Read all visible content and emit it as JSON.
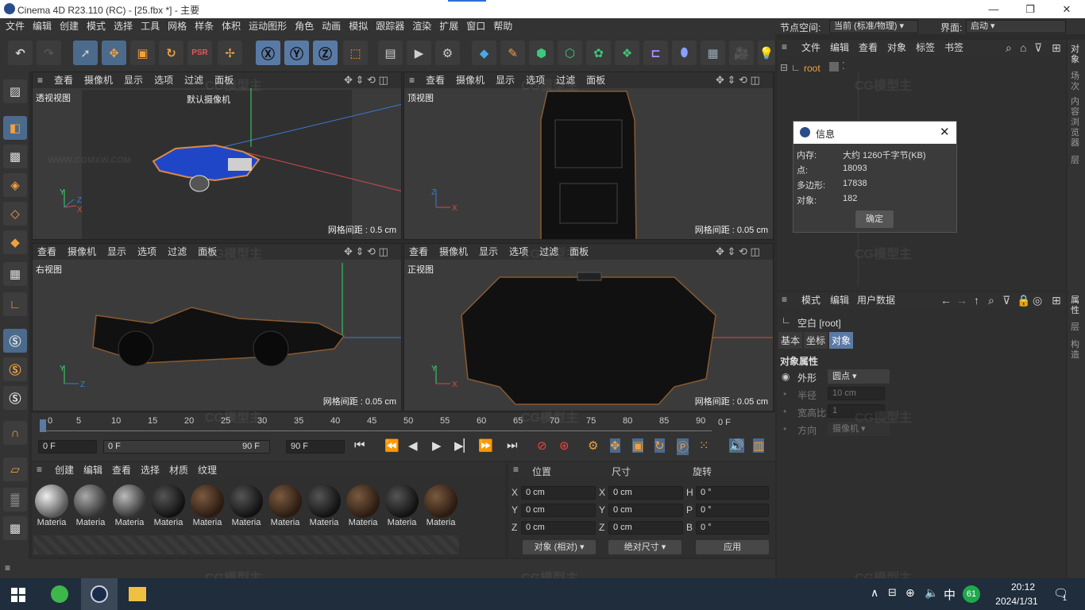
{
  "window": {
    "title": "Cinema 4D R23.110 (RC) - [25.fbx *] - 主要",
    "min": "—",
    "max": "❐",
    "close": "✕"
  },
  "menu": [
    "文件",
    "编辑",
    "创建",
    "模式",
    "选择",
    "工具",
    "网格",
    "样条",
    "体积",
    "运动图形",
    "角色",
    "动画",
    "模拟",
    "跟踪器",
    "渲染",
    "扩展",
    "窗口",
    "帮助"
  ],
  "node_space": {
    "label": "节点空间:",
    "value": "当前 (标准/物理)"
  },
  "interface": {
    "label": "界面:",
    "value": "启动"
  },
  "viewport_menu": [
    "查看",
    "摄像机",
    "显示",
    "选项",
    "过滤",
    "面板"
  ],
  "viewport_menu_short": [
    "查看",
    "摄像机",
    "显示",
    "选项",
    "过滤",
    "面板"
  ],
  "viewports": {
    "persp": {
      "name": "透视视图",
      "camera": "默认摄像机",
      "grid": "网格间距 : 0.5 cm"
    },
    "top": {
      "name": "顶视图",
      "grid": "网格间距 : 0.05 cm"
    },
    "right": {
      "name": "右视图",
      "grid": "网格间距 : 0.05 cm"
    },
    "front": {
      "name": "正视图",
      "grid": "网格间距 : 0.05 cm"
    }
  },
  "timeline": {
    "ticks": [
      "0",
      "5",
      "10",
      "15",
      "20",
      "25",
      "30",
      "35",
      "40",
      "45",
      "50",
      "55",
      "60",
      "65",
      "70",
      "75",
      "80",
      "85",
      "90"
    ],
    "end_frame": "0 F",
    "current": "0 F",
    "start": "0 F",
    "max_a": "90 F",
    "max_b": "90 F"
  },
  "materials": {
    "menu": [
      "创建",
      "编辑",
      "查看",
      "选择",
      "材质",
      "纹理"
    ],
    "label": "Materia",
    "count": 11
  },
  "coords": {
    "headers": {
      "pos": "位置",
      "size": "尺寸",
      "rot": "旋转"
    },
    "rows": [
      {
        "a": "X",
        "pos": "0 cm",
        "b": "X",
        "size": "0 cm",
        "c": "H",
        "rot": "0 °"
      },
      {
        "a": "Y",
        "pos": "0 cm",
        "b": "Y",
        "size": "0 cm",
        "c": "P",
        "rot": "0 °"
      },
      {
        "a": "Z",
        "pos": "0 cm",
        "b": "Z",
        "size": "0 cm",
        "c": "B",
        "rot": "0 °"
      }
    ],
    "mode": "对象 (相对)",
    "size_mode": "绝对尺寸",
    "apply": "应用"
  },
  "objects": {
    "menu": [
      "文件",
      "编辑",
      "查看",
      "对象",
      "标签",
      "书签"
    ],
    "root": "root"
  },
  "attributes": {
    "menu": [
      "模式",
      "编辑",
      "用户数据"
    ],
    "title": "空白 [root]",
    "tabs": [
      "基本",
      "坐标",
      "对象"
    ],
    "section": "对象属性",
    "fields": [
      {
        "label": "外形",
        "value": "圆点"
      },
      {
        "label": "半径",
        "value": "10 cm"
      },
      {
        "label": "宽高比",
        "value": "1"
      },
      {
        "label": "方向",
        "value": "摄像机"
      }
    ]
  },
  "side_tabs": [
    "对象",
    "场次",
    "内容浏览器",
    "层"
  ],
  "side_tabs2": [
    "属性",
    "层",
    "构造"
  ],
  "info_dialog": {
    "title": "信息",
    "rows": [
      {
        "k": "内存:",
        "v": "大约 1260千字节(KB)"
      },
      {
        "k": "点:",
        "v": "18093"
      },
      {
        "k": "多边形:",
        "v": "17838"
      },
      {
        "k": "对象:",
        "v": "182"
      }
    ],
    "ok": "确定"
  },
  "watermark": {
    "logo": "CG模型主",
    "url": "WWW.CGMXW.COM"
  },
  "taskbar": {
    "time": "20:12",
    "date": "2024/1/31",
    "ime": "中",
    "badge": "61",
    "notif": "1"
  }
}
